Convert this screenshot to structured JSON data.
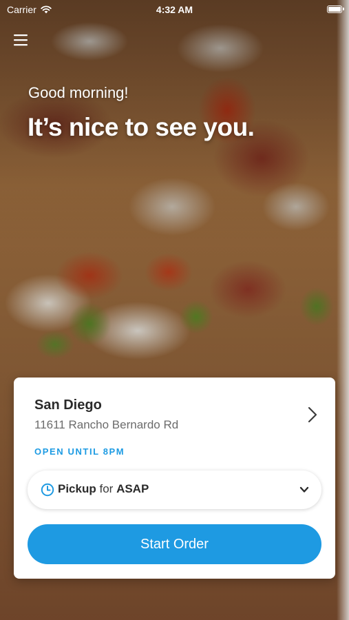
{
  "status_bar": {
    "carrier": "Carrier",
    "time": "4:32 AM"
  },
  "hero": {
    "greeting": "Good morning!",
    "headline": "It’s nice to see you."
  },
  "location": {
    "name": "San Diego",
    "address": "11611 Rancho Bernardo Rd",
    "hours": "OPEN UNTIL 8PM"
  },
  "order_mode": {
    "mode": "Pickup",
    "connector": "for",
    "time": "ASAP"
  },
  "actions": {
    "start_order": "Start Order"
  },
  "colors": {
    "accent": "#1e9ae2",
    "hours_text": "#1d9be3"
  },
  "icons": {
    "menu": "hamburger-menu-icon",
    "wifi": "wifi-icon",
    "battery": "battery-icon",
    "location_chevron": "chevron-right-icon",
    "clock": "clock-icon",
    "mode_chevron": "chevron-down-icon"
  }
}
